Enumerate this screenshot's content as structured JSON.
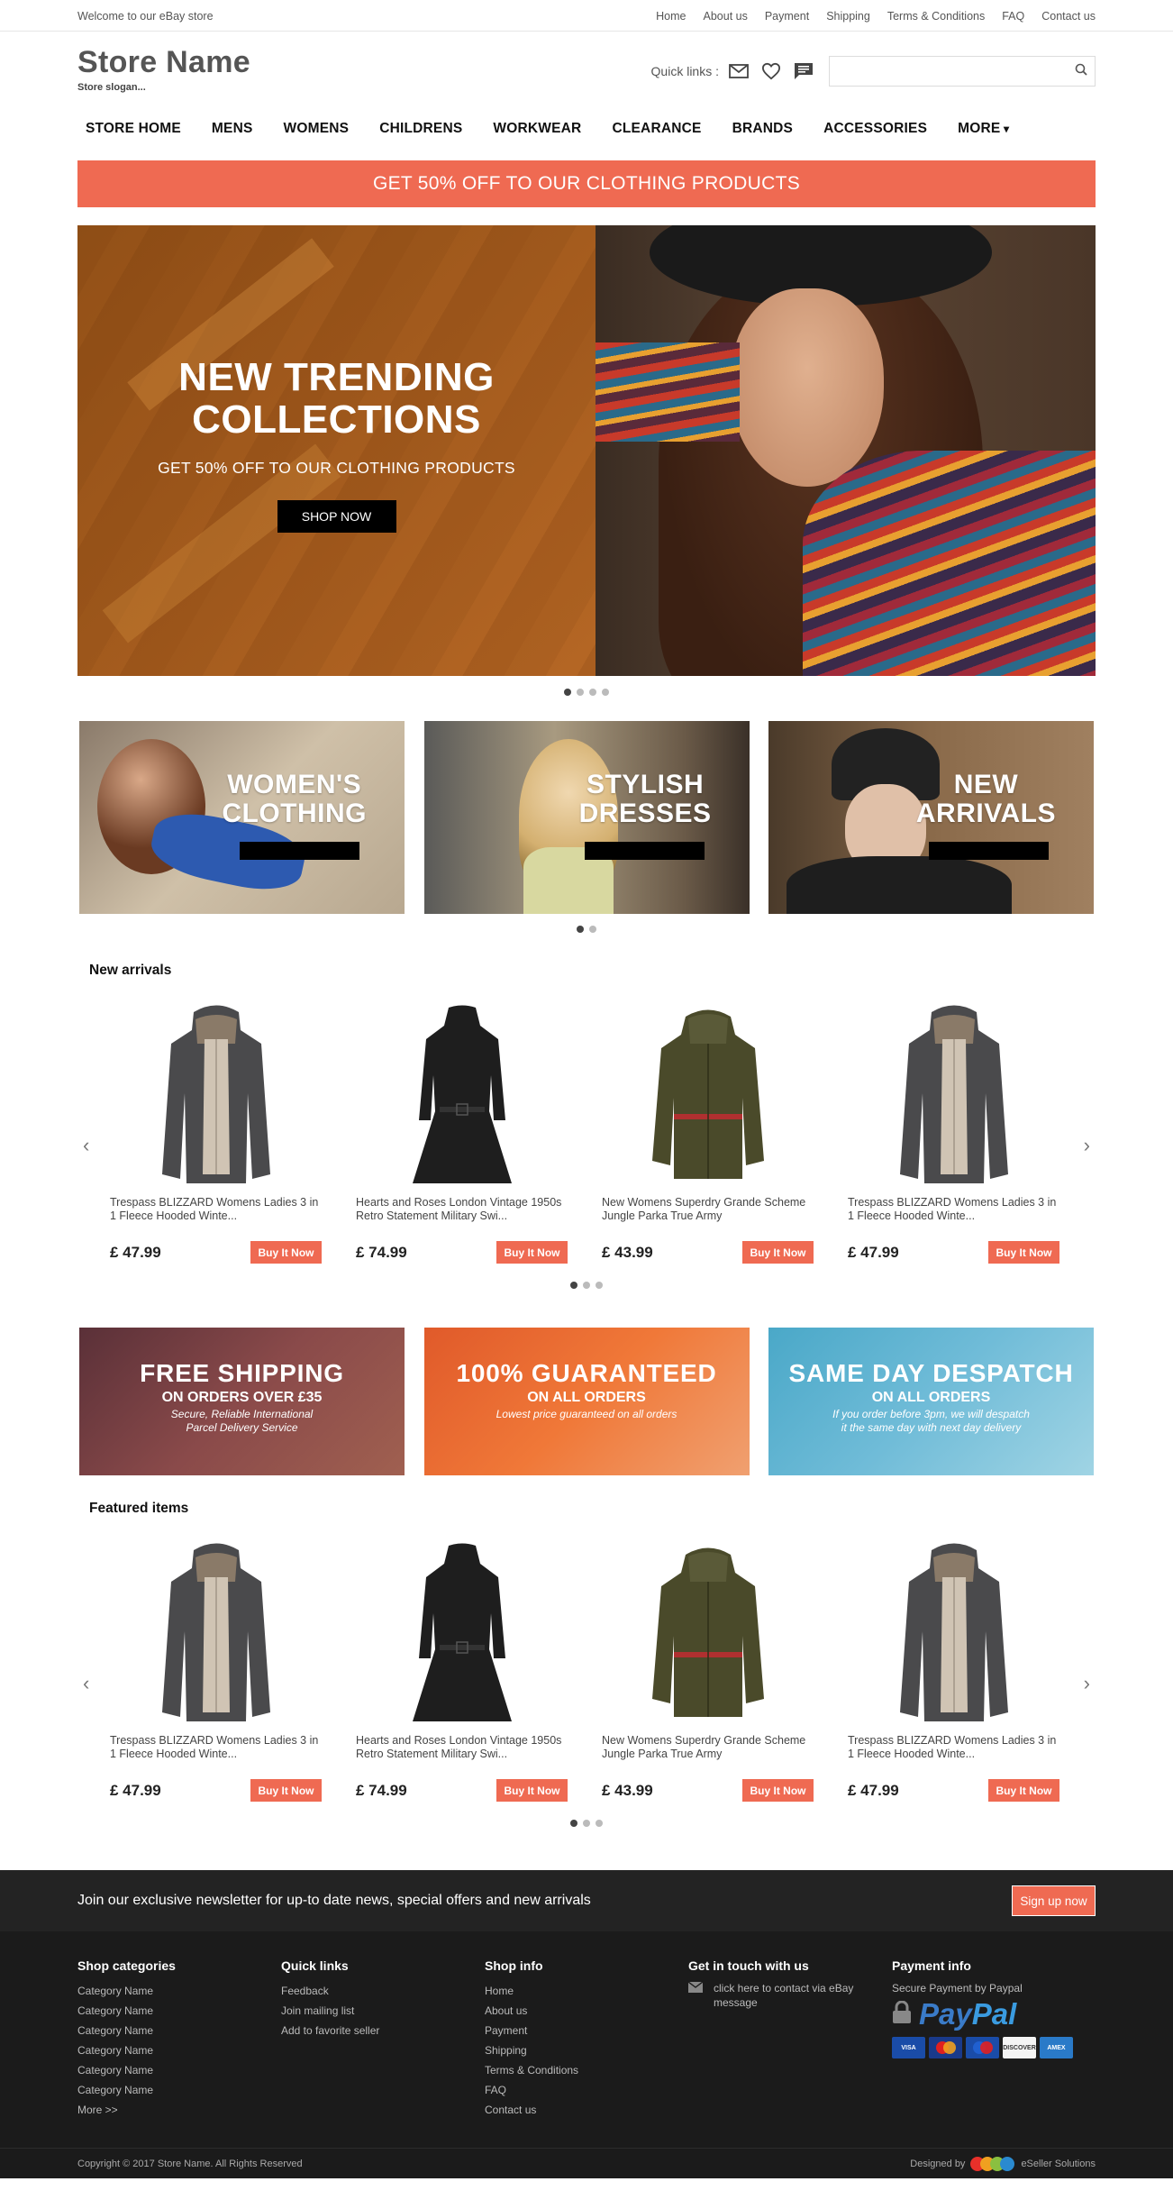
{
  "topbar": {
    "welcome": "Welcome to our eBay store",
    "links": [
      "Home",
      "About us",
      "Payment",
      "Shipping",
      "Terms & Conditions",
      "FAQ",
      "Contact us"
    ]
  },
  "header": {
    "store_name": "Store Name",
    "slogan": "Store slogan...",
    "quick_links_label": "Quick links :",
    "icons": [
      "mail-icon",
      "heart-icon",
      "chat-icon"
    ],
    "search_placeholder": ""
  },
  "nav": {
    "items": [
      "STORE HOME",
      "MENS",
      "WOMENS",
      "CHILDRENS",
      "WORKWEAR",
      "CLEARANCE",
      "BRANDS",
      "ACCESSORIES"
    ],
    "more": "MORE"
  },
  "promo": "GET 50% OFF TO OUR CLOTHING PRODUCTS",
  "hero": {
    "title_line1": "NEW TRENDING",
    "title_line2": "COLLECTIONS",
    "subtitle": "GET 50% OFF TO OUR CLOTHING PRODUCTS",
    "button": "SHOP NOW",
    "slides": 4,
    "active_slide": 1
  },
  "categories": [
    {
      "line1": "WOMEN'S",
      "line2": "CLOTHING"
    },
    {
      "line1": "STYLISH",
      "line2": "DRESSES"
    },
    {
      "line1": "NEW",
      "line2": "ARRIVALS"
    }
  ],
  "new_arrivals": {
    "title": "New arrivals",
    "products": [
      {
        "name": "Trespass BLIZZARD Womens Ladies 3 in 1 Fleece Hooded Winte...",
        "price": "£ 47.99",
        "button": "Buy It Now"
      },
      {
        "name": "Hearts and Roses London Vintage 1950s Retro Statement Military Swi...",
        "price": "£ 74.99",
        "button": "Buy It Now"
      },
      {
        "name": "New Womens Superdry Grande Scheme Jungle Parka True Army",
        "price": "£ 43.99",
        "button": "Buy It Now"
      },
      {
        "name": "Trespass BLIZZARD Womens Ladies 3 in 1 Fleece Hooded Winte...",
        "price": "£ 47.99",
        "button": "Buy It Now"
      }
    ]
  },
  "info_tiles": [
    {
      "title": "FREE SHIPPING",
      "sub": "ON ORDERS OVER £35",
      "desc1": "Secure, Reliable International",
      "desc2": "Parcel Delivery Service"
    },
    {
      "title": "100% GUARANTEED",
      "sub": "ON ALL ORDERS",
      "desc1": "Lowest price guaranteed on all orders",
      "desc2": ""
    },
    {
      "title": "SAME DAY DESPATCH",
      "sub": "ON ALL ORDERS",
      "desc1": "If you order before 3pm, we will despatch",
      "desc2": "it the same day with next day delivery"
    }
  ],
  "featured": {
    "title": "Featured items",
    "products": [
      {
        "name": "Trespass BLIZZARD Womens Ladies 3 in 1 Fleece Hooded Winte...",
        "price": "£ 47.99",
        "button": "Buy It Now"
      },
      {
        "name": "Hearts and Roses London Vintage 1950s Retro Statement Military Swi...",
        "price": "£ 74.99",
        "button": "Buy It Now"
      },
      {
        "name": "New Womens Superdry Grande Scheme Jungle Parka True Army",
        "price": "£ 43.99",
        "button": "Buy It Now"
      },
      {
        "name": "Trespass BLIZZARD Womens Ladies 3 in 1 Fleece Hooded Winte...",
        "price": "£ 47.99",
        "button": "Buy It Now"
      }
    ]
  },
  "newsletter": {
    "text": "Join our exclusive newsletter for up-to date news, special offers and new arrivals",
    "button": "Sign up now"
  },
  "footer": {
    "shop_categories": {
      "title": "Shop categories",
      "items": [
        "Category Name",
        "Category Name",
        "Category Name",
        "Category Name",
        "Category Name",
        "Category Name",
        "More >>"
      ]
    },
    "quick_links": {
      "title": "Quick links",
      "items": [
        "Feedback",
        "Join mailing list",
        "Add to favorite seller"
      ]
    },
    "shop_info": {
      "title": "Shop info",
      "items": [
        "Home",
        "About us",
        "Payment",
        "Shipping",
        "Terms & Conditions",
        "FAQ",
        "Contact us"
      ]
    },
    "contact": {
      "title": "Get in touch with us",
      "text": "click here to contact via eBay message"
    },
    "payment": {
      "title": "Payment info",
      "subtitle": "Secure Payment by Paypal",
      "logo_pay": "Pay",
      "logo_pal": "Pal",
      "cards": [
        "VISA",
        "MasterCard",
        "Maestro",
        "DISCOVER",
        "AMEX"
      ]
    }
  },
  "bottom": {
    "copyright": "Copyright © 2017 Store Name. All Rights Reserved",
    "designed_by": "Designed by",
    "company": "eSeller Solutions"
  },
  "colors": {
    "accent": "#ef6a52",
    "footer_bg": "#1b1b1b",
    "newsletter_bg": "#232323"
  }
}
